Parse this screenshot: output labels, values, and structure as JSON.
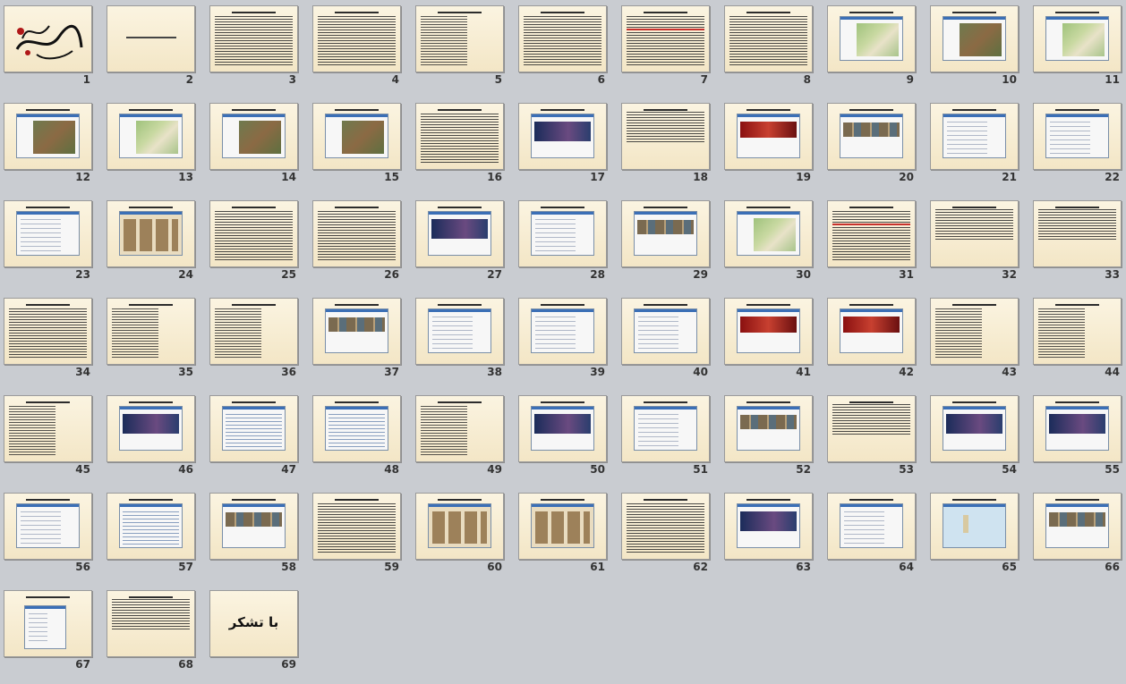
{
  "view": "slide-sorter",
  "slide_count": 69,
  "slides": [
    {
      "number": "1",
      "title": "",
      "kind": "logo"
    },
    {
      "number": "2",
      "title": "",
      "kind": "title"
    },
    {
      "number": "3",
      "title": "",
      "kind": "text"
    },
    {
      "number": "4",
      "title": "",
      "kind": "text"
    },
    {
      "number": "5",
      "title": "",
      "kind": "bullets"
    },
    {
      "number": "6",
      "title": "",
      "kind": "text"
    },
    {
      "number": "7",
      "title": "",
      "kind": "text-red"
    },
    {
      "number": "8",
      "title": "",
      "kind": "text"
    },
    {
      "number": "9",
      "title": "",
      "kind": "map"
    },
    {
      "number": "10",
      "title": "",
      "kind": "sat"
    },
    {
      "number": "11",
      "title": "",
      "kind": "map"
    },
    {
      "number": "12",
      "title": "",
      "kind": "sat"
    },
    {
      "number": "13",
      "title": "",
      "kind": "map"
    },
    {
      "number": "14",
      "title": "",
      "kind": "sat"
    },
    {
      "number": "15",
      "title": "",
      "kind": "sat"
    },
    {
      "number": "16",
      "title": "",
      "kind": "text"
    },
    {
      "number": "17",
      "title": "",
      "kind": "dark"
    },
    {
      "number": "18",
      "title": "",
      "kind": "text-half"
    },
    {
      "number": "19",
      "title": "",
      "kind": "red"
    },
    {
      "number": "20",
      "title": "",
      "kind": "photo"
    },
    {
      "number": "21",
      "title": "",
      "kind": "form"
    },
    {
      "number": "22",
      "title": "",
      "kind": "form"
    },
    {
      "number": "23",
      "title": "",
      "kind": "form"
    },
    {
      "number": "24",
      "title": "",
      "kind": "tan"
    },
    {
      "number": "25",
      "title": "",
      "kind": "text"
    },
    {
      "number": "26",
      "title": "",
      "kind": "text"
    },
    {
      "number": "27",
      "title": "",
      "kind": "dark"
    },
    {
      "number": "28",
      "title": "",
      "kind": "form"
    },
    {
      "number": "29",
      "title": "",
      "kind": "photo"
    },
    {
      "number": "30",
      "title": "",
      "kind": "map"
    },
    {
      "number": "31",
      "title": "",
      "kind": "text-red"
    },
    {
      "number": "32",
      "title": "",
      "kind": "text-half"
    },
    {
      "number": "33",
      "title": "",
      "kind": "text-half"
    },
    {
      "number": "34",
      "title": "",
      "kind": "text"
    },
    {
      "number": "35",
      "title": "",
      "kind": "bullets"
    },
    {
      "number": "36",
      "title": "",
      "kind": "bullets"
    },
    {
      "number": "37",
      "title": "",
      "kind": "photo"
    },
    {
      "number": "38",
      "title": "",
      "kind": "form"
    },
    {
      "number": "39",
      "title": "",
      "kind": "form"
    },
    {
      "number": "40",
      "title": "",
      "kind": "form"
    },
    {
      "number": "41",
      "title": "",
      "kind": "red"
    },
    {
      "number": "42",
      "title": "",
      "kind": "red"
    },
    {
      "number": "43",
      "title": "",
      "kind": "bullets"
    },
    {
      "number": "44",
      "title": "",
      "kind": "bullets"
    },
    {
      "number": "45",
      "title": "",
      "kind": "bullets"
    },
    {
      "number": "46",
      "title": "",
      "kind": "dark"
    },
    {
      "number": "47",
      "title": "",
      "kind": "grid"
    },
    {
      "number": "48",
      "title": "",
      "kind": "grid"
    },
    {
      "number": "49",
      "title": "",
      "kind": "bullets"
    },
    {
      "number": "50",
      "title": "",
      "kind": "dark"
    },
    {
      "number": "51",
      "title": "",
      "kind": "form"
    },
    {
      "number": "52",
      "title": "",
      "kind": "photo"
    },
    {
      "number": "53",
      "title": "",
      "kind": "text-half"
    },
    {
      "number": "54",
      "title": "",
      "kind": "dark"
    },
    {
      "number": "55",
      "title": "",
      "kind": "dark"
    },
    {
      "number": "56",
      "title": "",
      "kind": "form"
    },
    {
      "number": "57",
      "title": "",
      "kind": "grid"
    },
    {
      "number": "58",
      "title": "",
      "kind": "photo"
    },
    {
      "number": "59",
      "title": "",
      "kind": "text"
    },
    {
      "number": "60",
      "title": "",
      "kind": "tan"
    },
    {
      "number": "61",
      "title": "",
      "kind": "tan"
    },
    {
      "number": "62",
      "title": "",
      "kind": "text"
    },
    {
      "number": "63",
      "title": "",
      "kind": "dark"
    },
    {
      "number": "64",
      "title": "",
      "kind": "form"
    },
    {
      "number": "65",
      "title": "",
      "kind": "sea"
    },
    {
      "number": "66",
      "title": "",
      "kind": "photo"
    },
    {
      "number": "67",
      "title": "",
      "kind": "tall"
    },
    {
      "number": "68",
      "title": "",
      "kind": "text-half"
    },
    {
      "number": "69",
      "title": "با تشکر",
      "kind": "big"
    }
  ],
  "colors": {
    "background": "#c9ccd1",
    "slide_bg": "#fbf4e1",
    "accent_blue": "#3b6fb6",
    "accent_red": "#c01010"
  }
}
